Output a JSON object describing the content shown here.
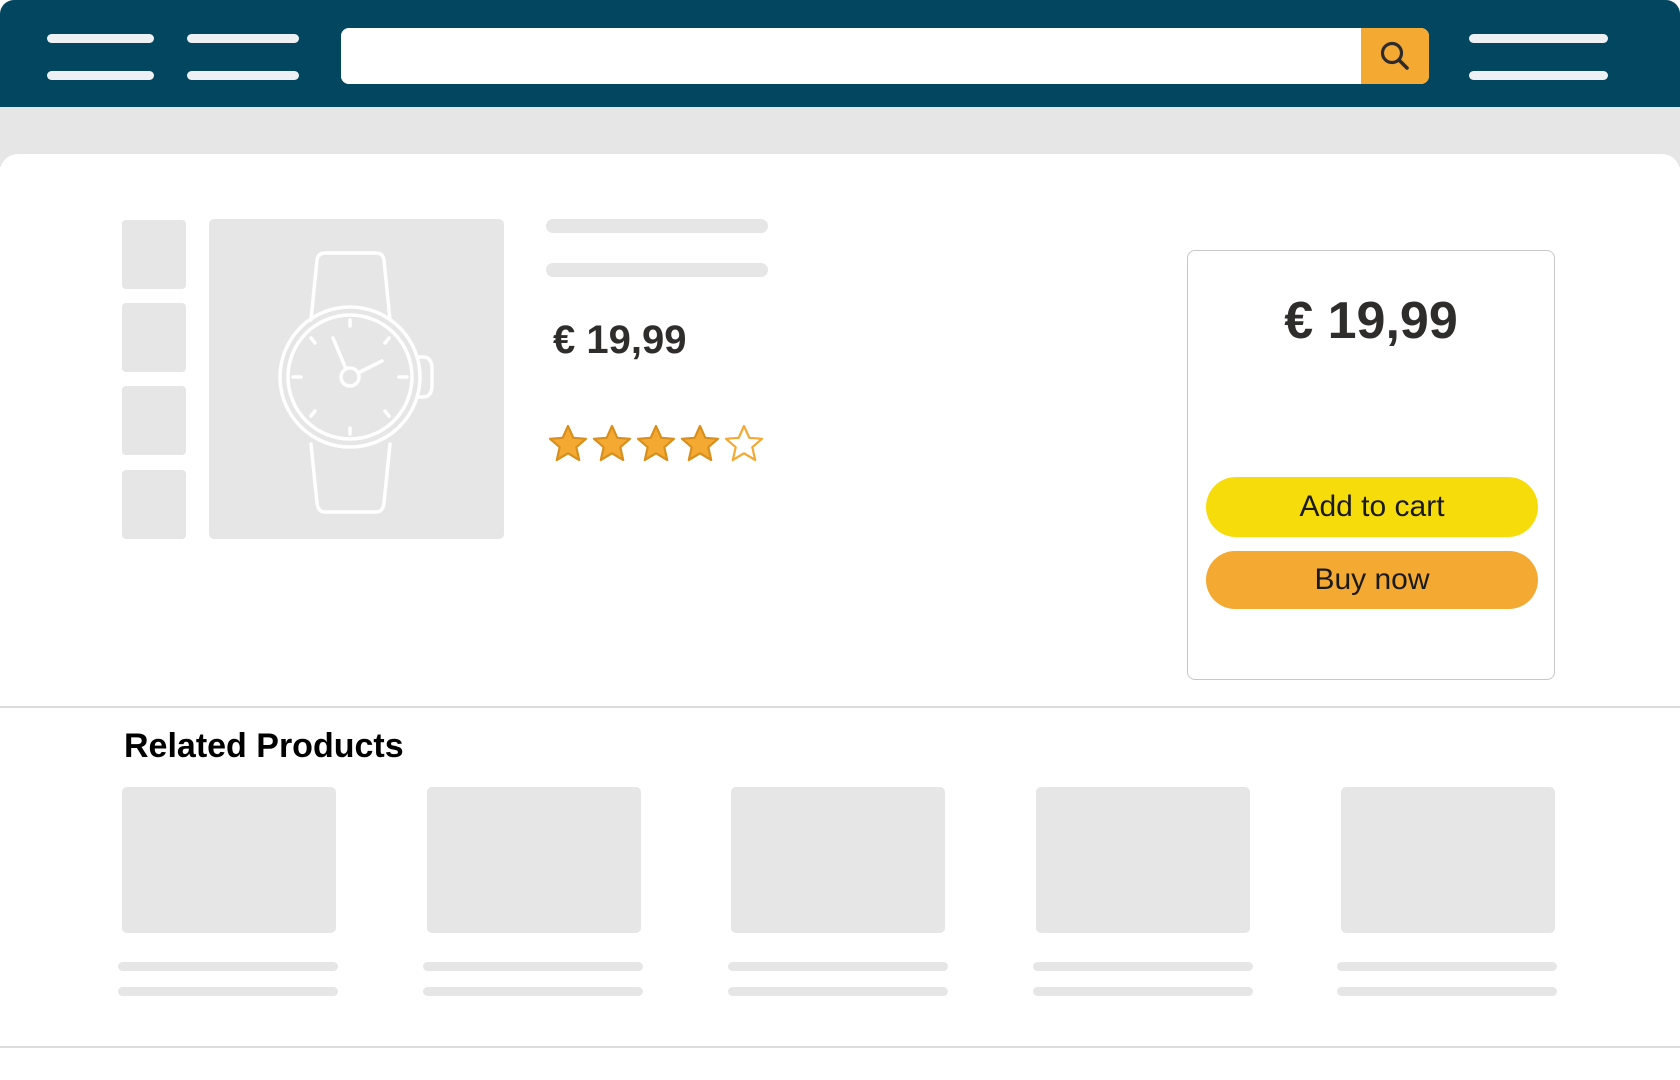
{
  "header": {
    "search": {
      "value": "",
      "placeholder": ""
    },
    "search_icon": "search-icon",
    "nav_icon": "menu-lines-icon"
  },
  "product": {
    "price": "€ 19,99",
    "rating": 4,
    "rating_max": 5,
    "image_icon": "wristwatch-icon"
  },
  "buybox": {
    "price": "€ 19,99",
    "add_to_cart": "Add to cart",
    "buy_now": "Buy now"
  },
  "related": {
    "title": "Related Products",
    "items": 5
  },
  "colors": {
    "header": "#03465f",
    "search_button": "#f4a933",
    "add_to_cart": "#f7dc0b",
    "buy_now": "#f4a933",
    "star_fill": "#f4a933",
    "placeholder": "#e6e6e6",
    "price_text": "#2f2c2c"
  }
}
